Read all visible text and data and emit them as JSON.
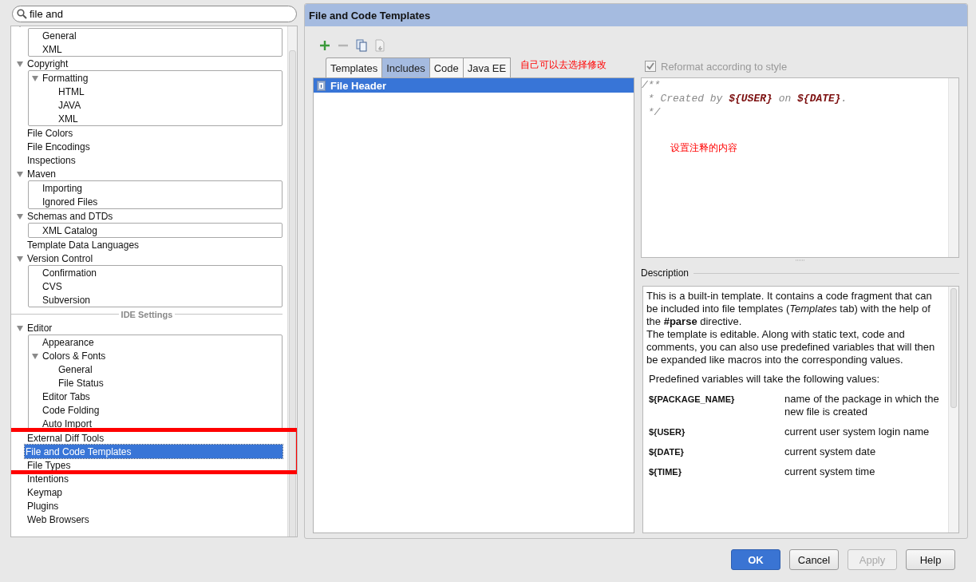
{
  "sidebar": {
    "search": {
      "value": "file and"
    },
    "project_settings": [
      {
        "children": [
          {
            "label": "General",
            "selected": false
          },
          {
            "label": "XML",
            "selected": false
          }
        ],
        "expanded": true
      },
      {
        "label": "Copyright",
        "selected": false,
        "expanded": true,
        "children": [
          {
            "label": "Formatting",
            "selected": false,
            "expanded": true,
            "children": [
              {
                "label": "HTML",
                "selected": false
              },
              {
                "label": "JAVA",
                "selected": false
              },
              {
                "label": "XML",
                "selected": false
              }
            ]
          }
        ]
      },
      {
        "label": "File Colors",
        "selected": false
      },
      {
        "label": "File Encodings",
        "selected": false
      },
      {
        "label": "Inspections",
        "selected": false
      },
      {
        "label": "Maven",
        "selected": false,
        "expanded": true,
        "children": [
          {
            "label": "Importing",
            "selected": false
          },
          {
            "label": "Ignored Files",
            "selected": false
          }
        ]
      },
      {
        "label": "Schemas and DTDs",
        "selected": false,
        "expanded": true,
        "children": [
          {
            "label": "XML Catalog",
            "selected": false
          }
        ]
      },
      {
        "label": "Template Data Languages",
        "selected": false
      },
      {
        "label": "Version Control",
        "selected": false,
        "expanded": true,
        "children": [
          {
            "label": "Confirmation",
            "selected": false
          },
          {
            "label": "CVS",
            "selected": false
          },
          {
            "label": "Subversion",
            "selected": false
          }
        ]
      }
    ],
    "section_label": "IDE Settings",
    "ide_settings": [
      {
        "label": "Editor",
        "selected": false,
        "expanded": true,
        "children": [
          {
            "label": "Appearance",
            "selected": false
          },
          {
            "label": "Colors & Fonts",
            "selected": false,
            "expanded": true,
            "children": [
              {
                "label": "General",
                "selected": false
              },
              {
                "label": "File Status",
                "selected": false
              }
            ]
          },
          {
            "label": "Editor Tabs",
            "selected": false
          },
          {
            "label": "Code Folding",
            "selected": false
          },
          {
            "label": "Auto Import",
            "selected": false
          }
        ]
      },
      {
        "label": "External Diff Tools",
        "selected": false
      },
      {
        "label": "File and Code Templates",
        "selected": true
      },
      {
        "label": "File Types",
        "selected": false
      },
      {
        "label": "Intentions",
        "selected": false
      },
      {
        "label": "Keymap",
        "selected": false
      },
      {
        "label": "Plugins",
        "selected": false
      },
      {
        "label": "Web Browsers",
        "selected": false
      }
    ]
  },
  "panel": {
    "title": "File and Code Templates",
    "toolbar": [
      {
        "kind": "add",
        "disabled": false
      },
      {
        "kind": "remove",
        "disabled": true
      },
      {
        "kind": "copy",
        "disabled": false
      },
      {
        "kind": "reset",
        "disabled": true
      }
    ],
    "tabs": [
      {
        "label": "Templates",
        "selected": false
      },
      {
        "label": "Includes",
        "selected": true
      },
      {
        "label": "Code",
        "selected": false
      },
      {
        "label": "Java EE",
        "selected": false
      }
    ],
    "templates": [
      {
        "label": "File Header",
        "selected": true
      }
    ],
    "reformat": {
      "label": "Reformat according to style",
      "checked": true,
      "disabled": true
    },
    "editor_lines": [
      [
        {
          "text": "/**",
          "kind": "comment"
        }
      ],
      [
        {
          "text": " * Created by ",
          "kind": "comment"
        },
        {
          "text": "${USER}",
          "kind": "variable"
        },
        {
          "text": " on ",
          "kind": "comment"
        },
        {
          "text": "${DATE}",
          "kind": "variable"
        },
        {
          "text": ".",
          "kind": "comment"
        }
      ],
      [
        {
          "text": " */",
          "kind": "comment"
        }
      ]
    ],
    "description_label": "Description",
    "description": [
      "This is a built-in template. It contains a code fragment that can be included into file templates (*Templates* tab) with the help of the **#parse** directive.",
      "The template is editable. Along with static text, code and comments, you can also use predefined variables that will then be expanded like macros into the corresponding values."
    ],
    "variables_intro": "Predefined variables will take the following values:",
    "variables": [
      {
        "name": "${PACKAGE_NAME}",
        "meaning": "name of the package in which the new file is created"
      },
      {
        "name": "${USER}",
        "meaning": "current user system login name"
      },
      {
        "name": "${DATE}",
        "meaning": "current system date"
      },
      {
        "name": "${TIME}",
        "meaning": "current system time"
      }
    ]
  },
  "annotations": {
    "tabs_note": "自己可以去选择修改",
    "editor_note": "设置注释的内容"
  },
  "buttons": [
    {
      "label": "OK",
      "default": true,
      "disabled": false
    },
    {
      "label": "Cancel",
      "default": false,
      "disabled": false
    },
    {
      "label": "Apply",
      "default": false,
      "disabled": true
    },
    {
      "label": "Help",
      "default": false,
      "disabled": false
    }
  ]
}
